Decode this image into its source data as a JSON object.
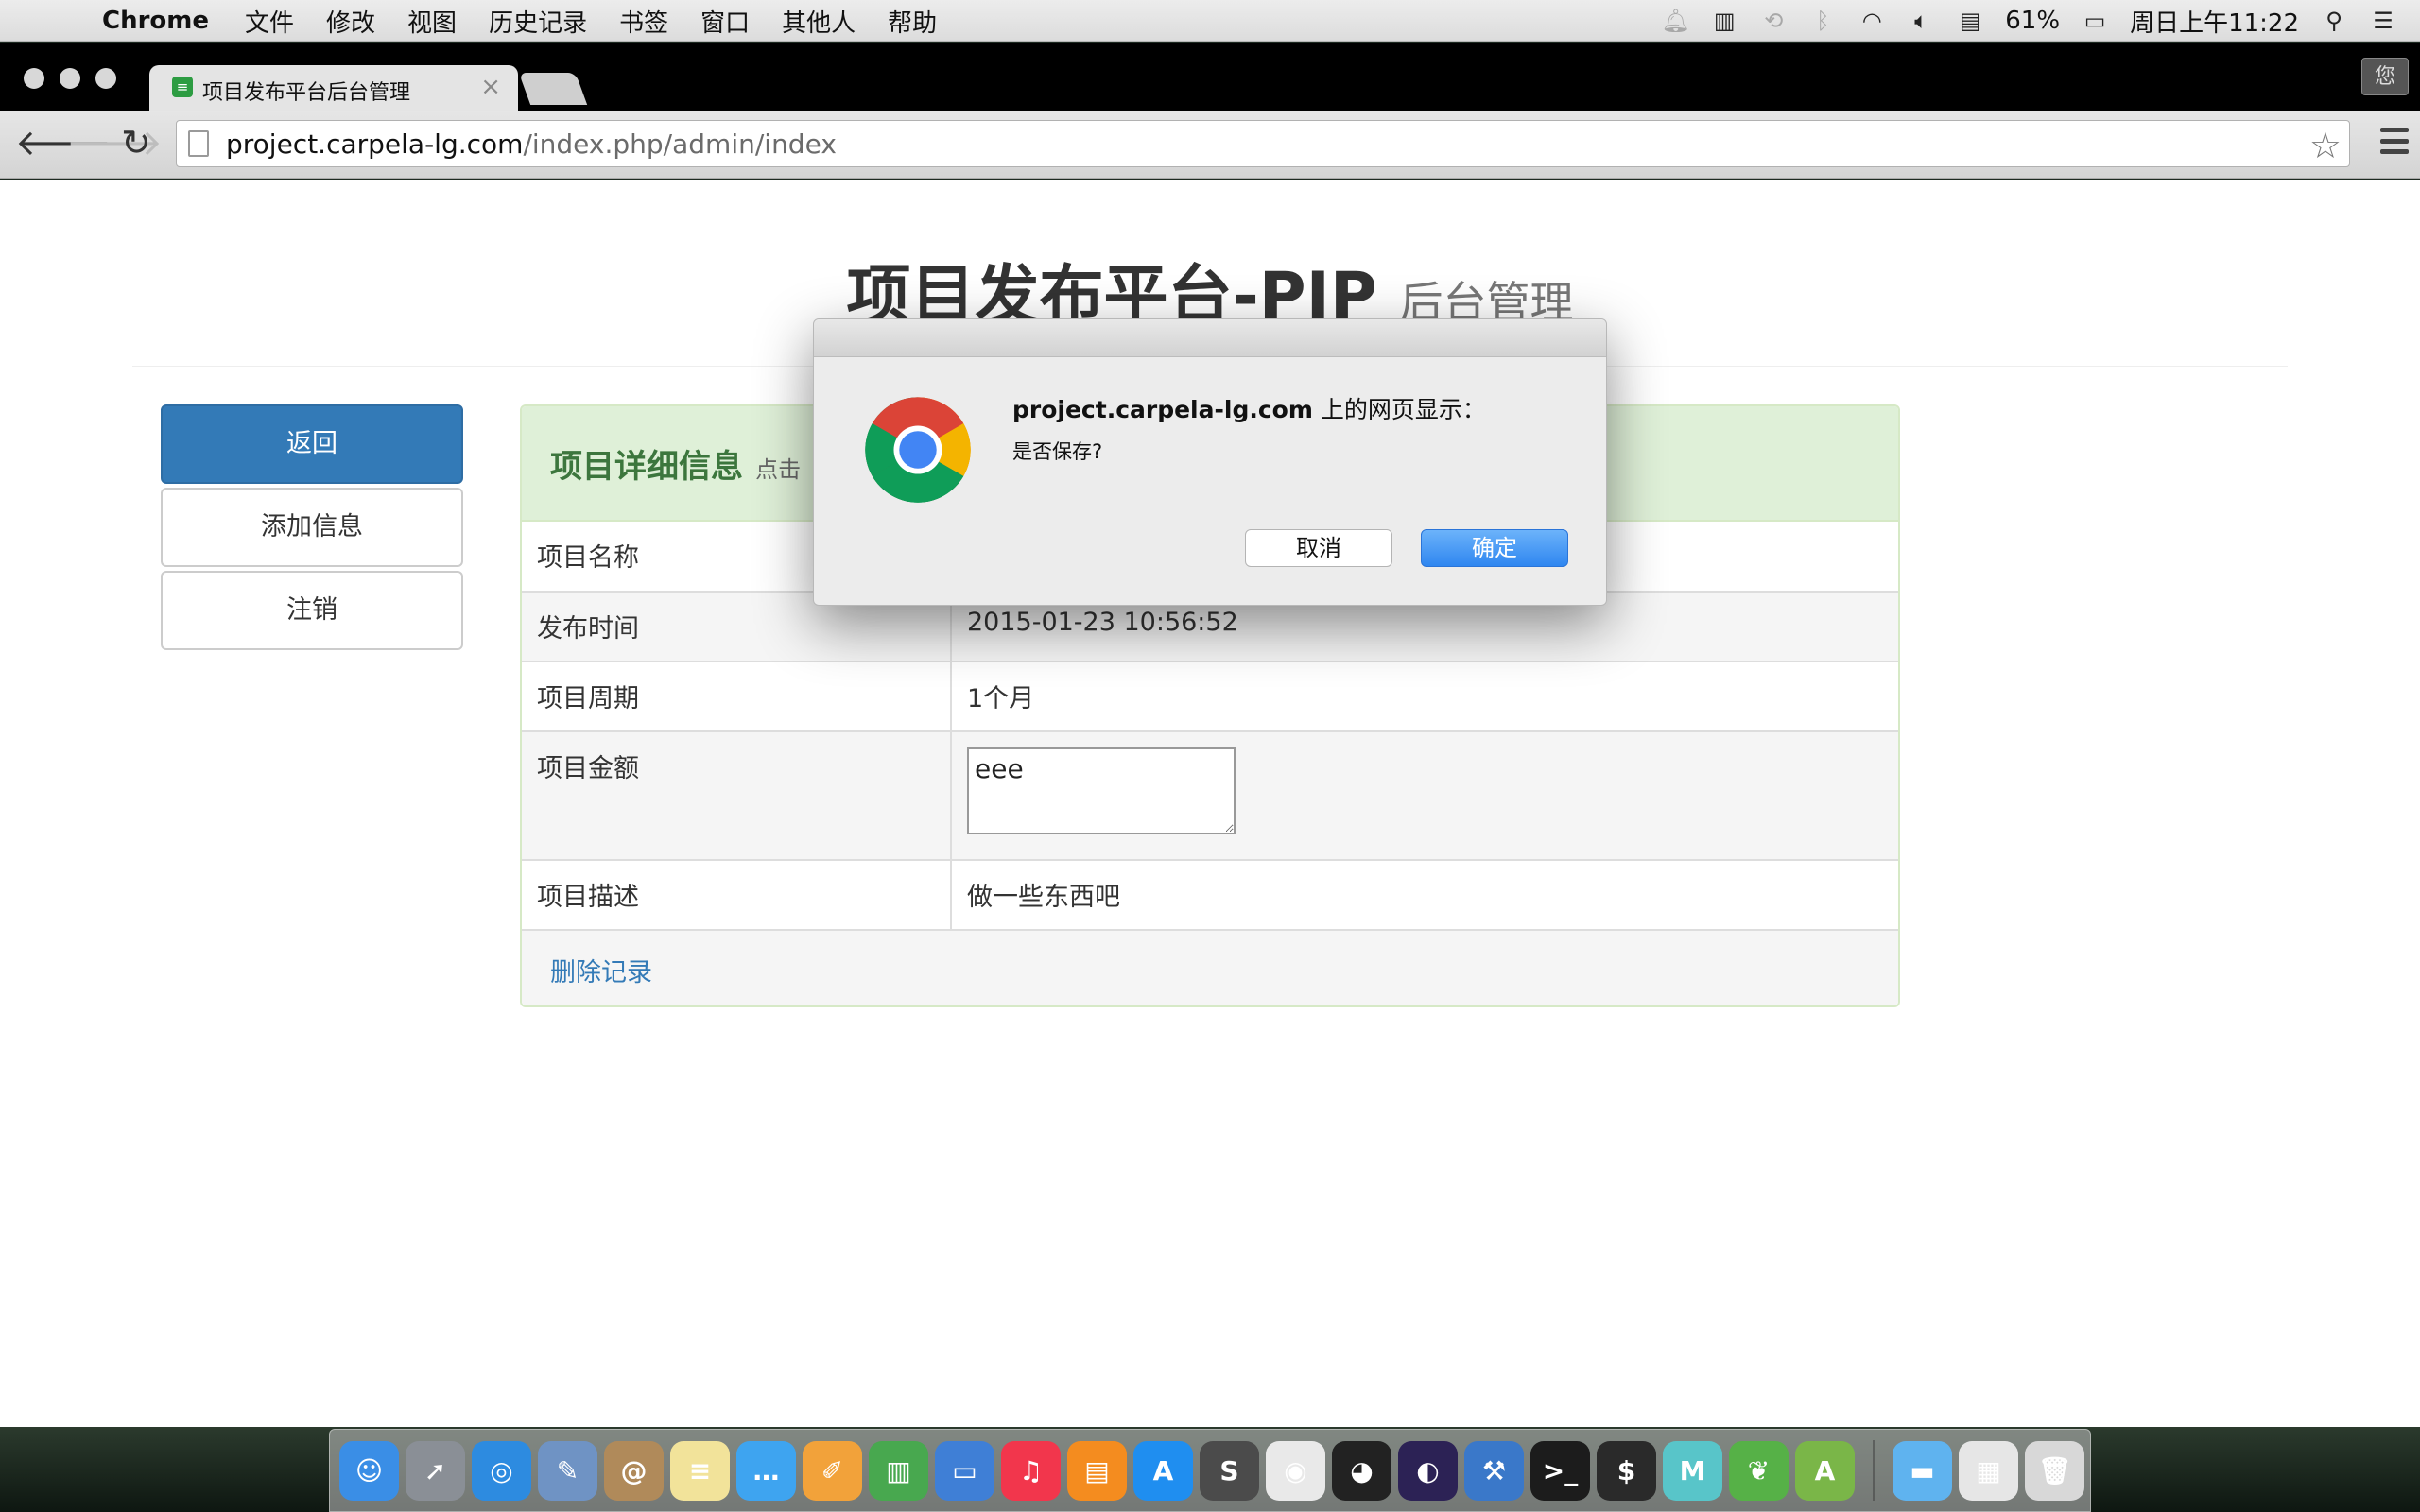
{
  "menubar": {
    "app_name": "Chrome",
    "items": [
      "文件",
      "修改",
      "视图",
      "历史记录",
      "书签",
      "窗口",
      "其他人",
      "帮助"
    ],
    "battery": "61%",
    "clock": "周日上午11:22"
  },
  "browser": {
    "tab_title": "项目发布平台后台管理",
    "tab_favicon": "list-favicon",
    "profile_label": "您",
    "url_host": "project.carpela-lg.com",
    "url_path": "/index.php/admin/index"
  },
  "page": {
    "title_main": "项目发布平台-PIP",
    "title_sub": "后台管理",
    "sidebar": {
      "back": "返回",
      "add_info": "添加信息",
      "logout": "注销"
    },
    "panel": {
      "title": "项目详细信息",
      "subtitle": "点击",
      "rows": [
        {
          "label": "项目名称",
          "value": ""
        },
        {
          "label": "发布时间",
          "value": "2015-01-23 10:56:52"
        },
        {
          "label": "项目周期",
          "value": "1个月"
        },
        {
          "label": "项目金额",
          "value": "eee"
        },
        {
          "label": "项目描述",
          "value": "做一些东西吧"
        }
      ],
      "delete_link": "删除记录"
    }
  },
  "dialog": {
    "host": "project.carpela-lg.com",
    "host_suffix": " 上的网页显示：",
    "message": "是否保存?",
    "cancel": "取消",
    "ok": "确定"
  },
  "dock": {
    "apps": [
      {
        "name": "finder-icon",
        "color": "#3a8ee6",
        "glyph": "☺"
      },
      {
        "name": "launchpad-icon",
        "color": "#8a8f96",
        "glyph": "➚"
      },
      {
        "name": "safari-icon",
        "color": "#2d8be0",
        "glyph": "◎"
      },
      {
        "name": "preview-icon",
        "color": "#6f93c4",
        "glyph": "✎"
      },
      {
        "name": "contacts-icon",
        "color": "#b08a5a",
        "glyph": "@"
      },
      {
        "name": "notes-icon",
        "color": "#f2e39a",
        "glyph": "≡"
      },
      {
        "name": "messages-icon",
        "color": "#3ea4f0",
        "glyph": "…"
      },
      {
        "name": "pages-icon",
        "color": "#f2a23a",
        "glyph": "✐"
      },
      {
        "name": "numbers-icon",
        "color": "#48a84f",
        "glyph": "▥"
      },
      {
        "name": "keynote-icon",
        "color": "#3f7fd6",
        "glyph": "▭"
      },
      {
        "name": "itunes-icon",
        "color": "#f2364c",
        "glyph": "♫"
      },
      {
        "name": "ibooks-icon",
        "color": "#f48c1f",
        "glyph": "▤"
      },
      {
        "name": "app-store-icon",
        "color": "#1f8ef0",
        "glyph": "A"
      },
      {
        "name": "sublime-text-icon",
        "color": "#4b4b4b",
        "glyph": "S"
      },
      {
        "name": "chrome-icon",
        "color": "#e9e9e9",
        "glyph": "◉"
      },
      {
        "name": "qq-icon",
        "color": "#222222",
        "glyph": "◕"
      },
      {
        "name": "eclipse-icon",
        "color": "#2c2255",
        "glyph": "◐"
      },
      {
        "name": "xcode-icon",
        "color": "#3a78c9",
        "glyph": "⚒"
      },
      {
        "name": "terminal-icon",
        "color": "#1c1c1c",
        "glyph": ">_"
      },
      {
        "name": "iterm-icon",
        "color": "#2a2a2a",
        "glyph": "$"
      },
      {
        "name": "mou-icon",
        "color": "#58c5c9",
        "glyph": "M"
      },
      {
        "name": "evernote-icon",
        "color": "#56b147",
        "glyph": "❦"
      },
      {
        "name": "android-studio-icon",
        "color": "#7ab648",
        "glyph": "A"
      }
    ],
    "right_items": [
      {
        "name": "applications-folder-icon",
        "color": "#5fb3ef",
        "glyph": "▬"
      },
      {
        "name": "downloads-stack-icon",
        "color": "#e6e6e6",
        "glyph": "▦"
      },
      {
        "name": "trash-icon",
        "color": "#d8d8d8",
        "glyph": "🗑"
      }
    ]
  }
}
